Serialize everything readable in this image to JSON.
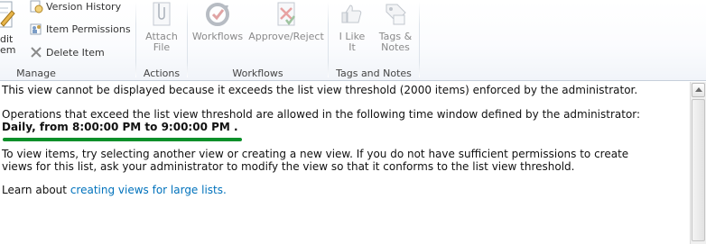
{
  "ribbon": {
    "manage": {
      "label": "Manage",
      "edit_item_line1": "dit",
      "edit_item_line2": "em",
      "version_history": "Version History",
      "item_permissions": "Item Permissions",
      "delete_item": "Delete Item"
    },
    "actions": {
      "label": "Actions",
      "attach_file_line1": "Attach",
      "attach_file_line2": "File"
    },
    "workflows": {
      "label": "Workflows",
      "workflows": "Workflows",
      "approve_reject": "Approve/Reject"
    },
    "tags_notes": {
      "label": "Tags and Notes",
      "i_like_it_line1": "I Like",
      "i_like_it_line2": "It",
      "tags_notes_line1": "Tags &",
      "tags_notes_line2": "Notes"
    }
  },
  "message": {
    "line1": "This view cannot be displayed because it exceeds the list view threshold (2000 items) enforced by the administrator.",
    "line2": "Operations that exceed the list view threshold are allowed in the following time window defined by the administrator:",
    "time_window": "Daily, from 8:00:00 PM to 9:00:00 PM .",
    "line3a": "To view items, try selecting another view or creating a new view. If you do not have sufficient permissions to create",
    "line3b": "views for this list, ask your administrator to modify the view so that it conforms to the list view threshold.",
    "learn_prefix": "Learn about",
    "learn_link": "creating views for large lists."
  },
  "colors": {
    "link": "#0072bc",
    "highlight_underline": "#0b8f2a"
  }
}
